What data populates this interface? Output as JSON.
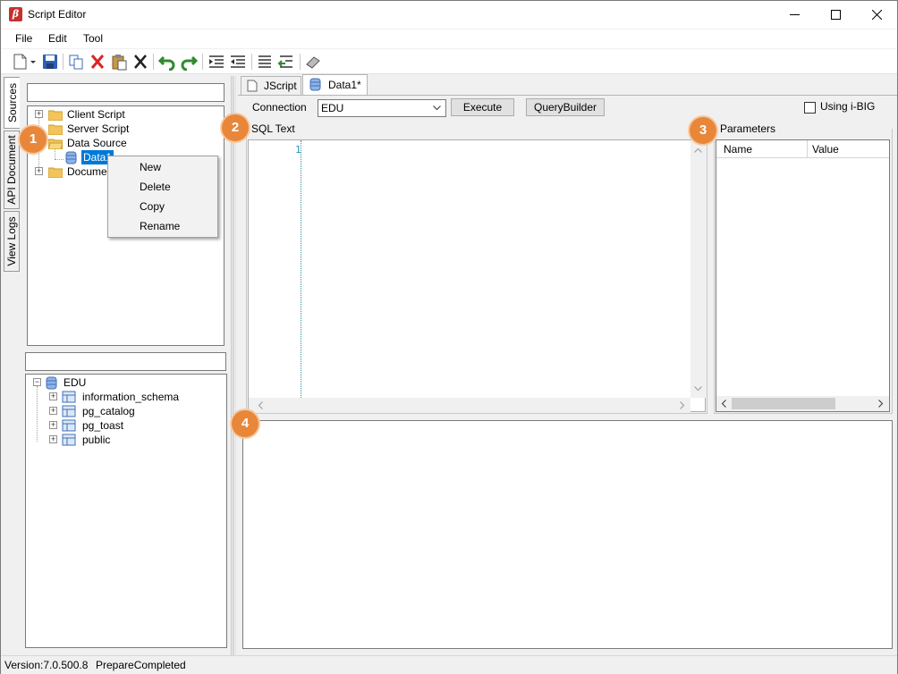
{
  "window": {
    "title": "Script Editor"
  },
  "menu": [
    "File",
    "Edit",
    "Tool"
  ],
  "vertical_tabs": [
    "Sources",
    "API Document",
    "View Logs"
  ],
  "source_tree": {
    "items": [
      "Client Script",
      "Server Script",
      "Data Source",
      "Data1",
      "Docume"
    ]
  },
  "context_menu": [
    "New",
    "Delete",
    "Copy",
    "Rename"
  ],
  "db_tree": {
    "root": "EDU",
    "schemas": [
      "information_schema",
      "pg_catalog",
      "pg_toast",
      "public"
    ]
  },
  "editor_tabs": [
    "JScript",
    "Data1*"
  ],
  "connection": {
    "label": "Connection",
    "value": "EDU",
    "execute_label": "Execute",
    "querybuilder_label": "QueryBuilder",
    "using_ibig_label": "Using i-BIG"
  },
  "sql": {
    "label": "SQL Text",
    "line_number": "1"
  },
  "parameters": {
    "label": "Parameters",
    "columns": [
      "Name",
      "Value"
    ]
  },
  "badges": [
    "1",
    "2",
    "3",
    "4"
  ],
  "status": {
    "version": "Version:7.0.500.8",
    "state": "PrepareCompleted"
  },
  "colors": {
    "accent_badge": "#e8873a",
    "selection": "#0078d7"
  }
}
